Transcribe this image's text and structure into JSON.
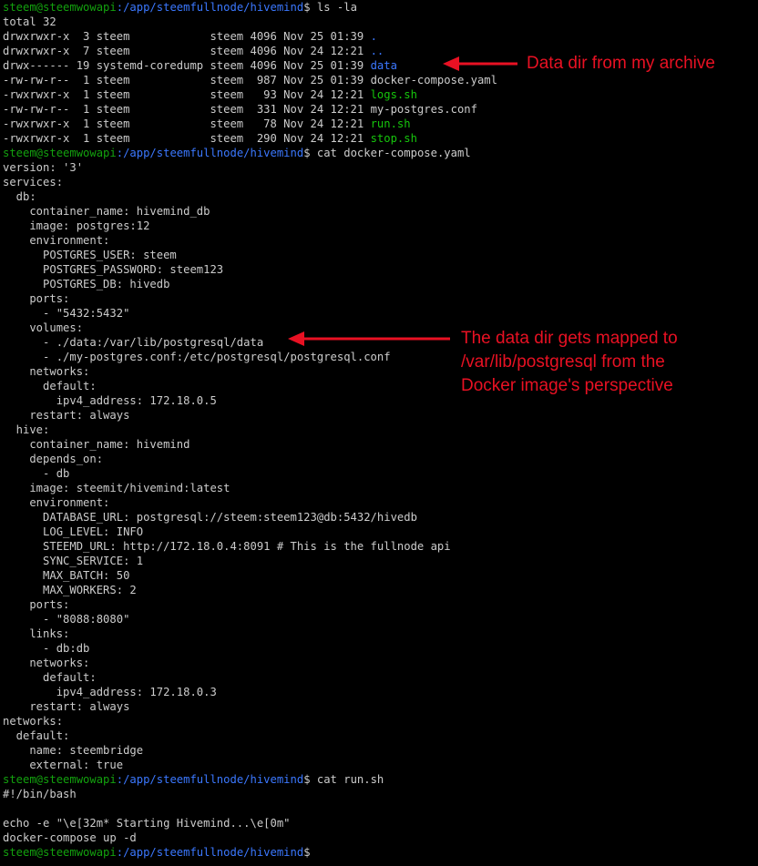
{
  "prompt": {
    "user": "steem@steemwowapi",
    "path": ":/app/steemfullnode/hivemind",
    "symbol": "$"
  },
  "commands": {
    "ls": " ls -la",
    "cat_compose": " cat docker-compose.yaml",
    "cat_run": " cat run.sh"
  },
  "listing": {
    "total": "total 32",
    "rows": [
      {
        "meta": "drwxrwxr-x  3 steem            steem 4096 Nov 25 01:39 ",
        "name": ".",
        "kind": "dir"
      },
      {
        "meta": "drwxrwxr-x  7 steem            steem 4096 Nov 24 12:21 ",
        "name": "..",
        "kind": "dir"
      },
      {
        "meta": "drwx------ 19 systemd-coredump steem 4096 Nov 25 01:39 ",
        "name": "data",
        "kind": "dir"
      },
      {
        "meta": "-rw-rw-r--  1 steem            steem  987 Nov 25 01:39 ",
        "name": "docker-compose.yaml",
        "kind": "file"
      },
      {
        "meta": "-rwxrwxr-x  1 steem            steem   93 Nov 24 12:21 ",
        "name": "logs.sh",
        "kind": "exe"
      },
      {
        "meta": "-rw-rw-r--  1 steem            steem  331 Nov 24 12:21 ",
        "name": "my-postgres.conf",
        "kind": "file"
      },
      {
        "meta": "-rwxrwxr-x  1 steem            steem   78 Nov 24 12:21 ",
        "name": "run.sh",
        "kind": "exe"
      },
      {
        "meta": "-rwxrwxr-x  1 steem            steem  290 Nov 24 12:21 ",
        "name": "stop.sh",
        "kind": "exe"
      }
    ]
  },
  "compose_lines": [
    "version: '3'",
    "services:",
    "  db:",
    "    container_name: hivemind_db",
    "    image: postgres:12",
    "    environment:",
    "      POSTGRES_USER: steem",
    "      POSTGRES_PASSWORD: steem123",
    "      POSTGRES_DB: hivedb",
    "    ports:",
    "      - \"5432:5432\"",
    "    volumes:",
    "      - ./data:/var/lib/postgresql/data",
    "      - ./my-postgres.conf:/etc/postgresql/postgresql.conf",
    "    networks:",
    "      default:",
    "        ipv4_address: 172.18.0.5",
    "    restart: always",
    "  hive:",
    "    container_name: hivemind",
    "    depends_on:",
    "      - db",
    "    image: steemit/hivemind:latest",
    "    environment:",
    "      DATABASE_URL: postgresql://steem:steem123@db:5432/hivedb",
    "      LOG_LEVEL: INFO",
    "      STEEMD_URL: http://172.18.0.4:8091 # This is the fullnode api",
    "      SYNC_SERVICE: 1",
    "      MAX_BATCH: 50",
    "      MAX_WORKERS: 2",
    "    ports:",
    "      - \"8088:8080\"",
    "    links:",
    "      - db:db",
    "    networks:",
    "      default:",
    "        ipv4_address: 172.18.0.3",
    "    restart: always",
    "networks:",
    "  default:",
    "    name: steembridge",
    "    external: true"
  ],
  "run_lines": [
    "#!/bin/bash",
    "",
    "echo -e \"\\e[32m* Starting Hivemind...\\e[0m\"",
    "docker-compose up -d"
  ],
  "annotations": {
    "data_dir": "Data dir from my archive",
    "mapping": "The data dir gets mapped to\n/var/lib/postgresql from the\nDocker image's perspective"
  },
  "colors": {
    "background": "#000000",
    "foreground": "#cccccc",
    "prompt_user": "#13a10e",
    "prompt_path": "#3b78ff",
    "directory": "#3b78ff",
    "executable": "#16c60c",
    "annotation": "#e81123"
  }
}
